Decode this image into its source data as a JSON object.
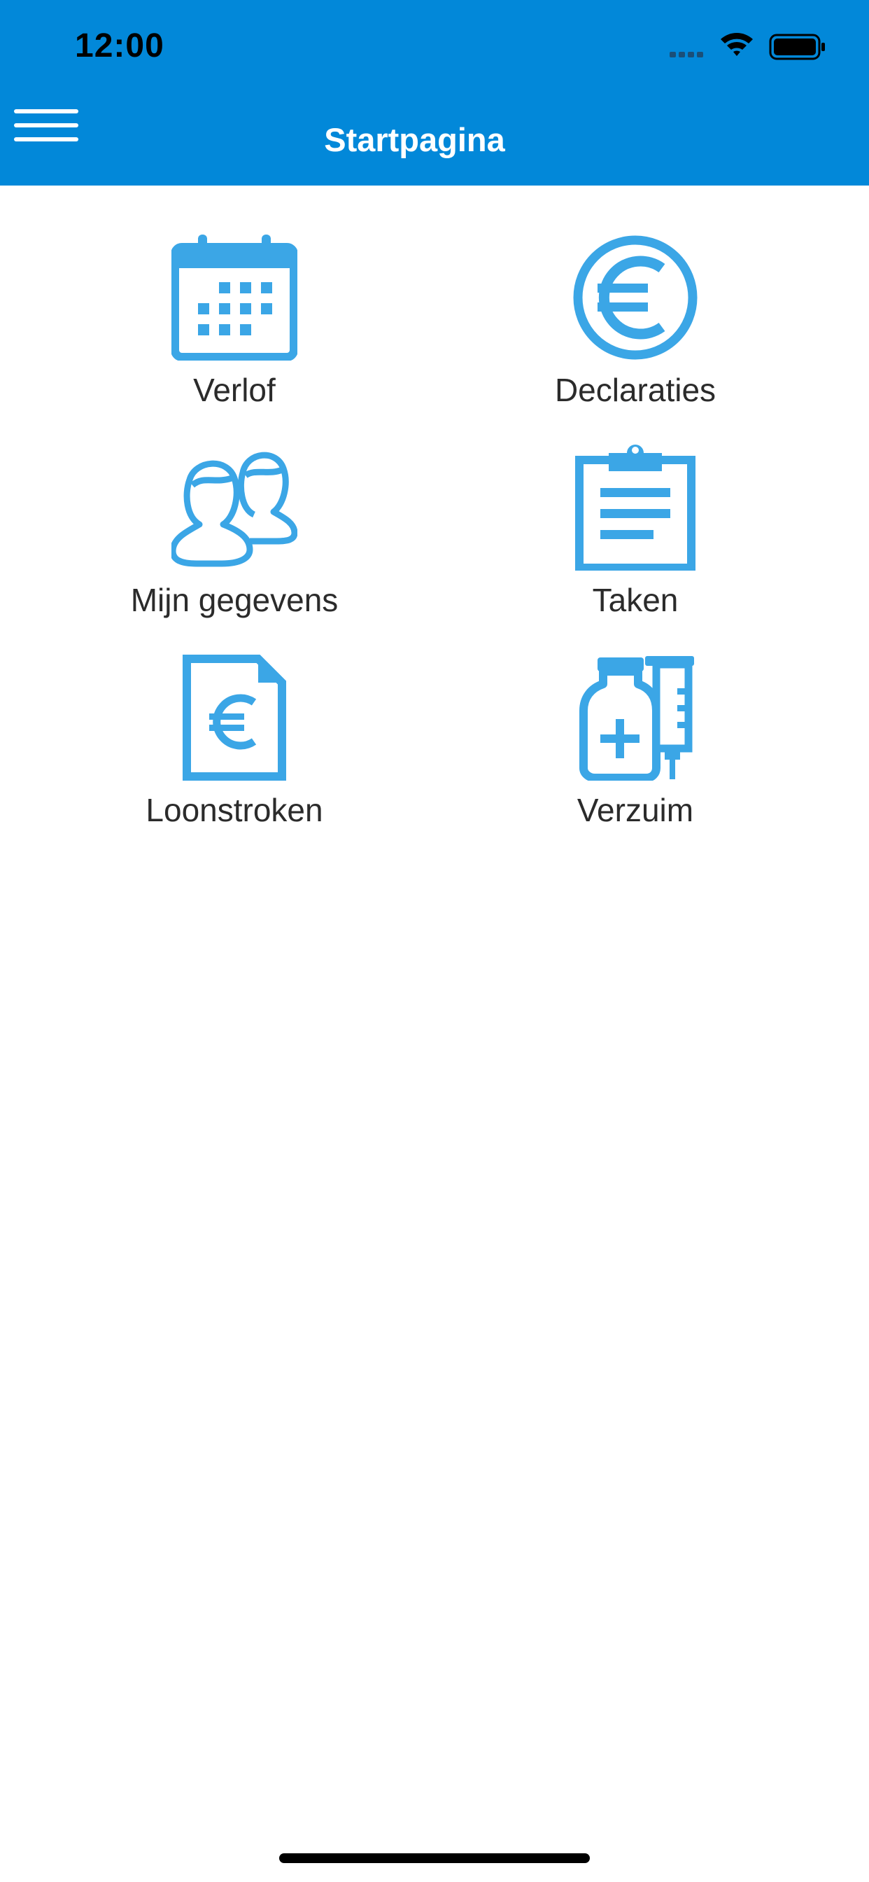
{
  "status_bar": {
    "time": "12:00",
    "icons": [
      "signal-icon",
      "wifi-icon",
      "battery-icon"
    ]
  },
  "header": {
    "title": "Startpagina",
    "background_color": "#0288d9",
    "menu_icon": "hamburger-menu-icon"
  },
  "tiles": [
    {
      "label": "Verlof",
      "icon": "calendar-icon"
    },
    {
      "label": "Declaraties",
      "icon": "euro-icon"
    },
    {
      "label": "Mijn gegevens",
      "icon": "people-icon"
    },
    {
      "label": "Taken",
      "icon": "clipboard-icon"
    },
    {
      "label": "Loonstroken",
      "icon": "payslip-document-icon"
    },
    {
      "label": "Verzuim",
      "icon": "medicine-syringe-icon"
    }
  ],
  "colors": {
    "icon_blue": "#3ba6e6",
    "label_text": "#2b2b2b"
  }
}
